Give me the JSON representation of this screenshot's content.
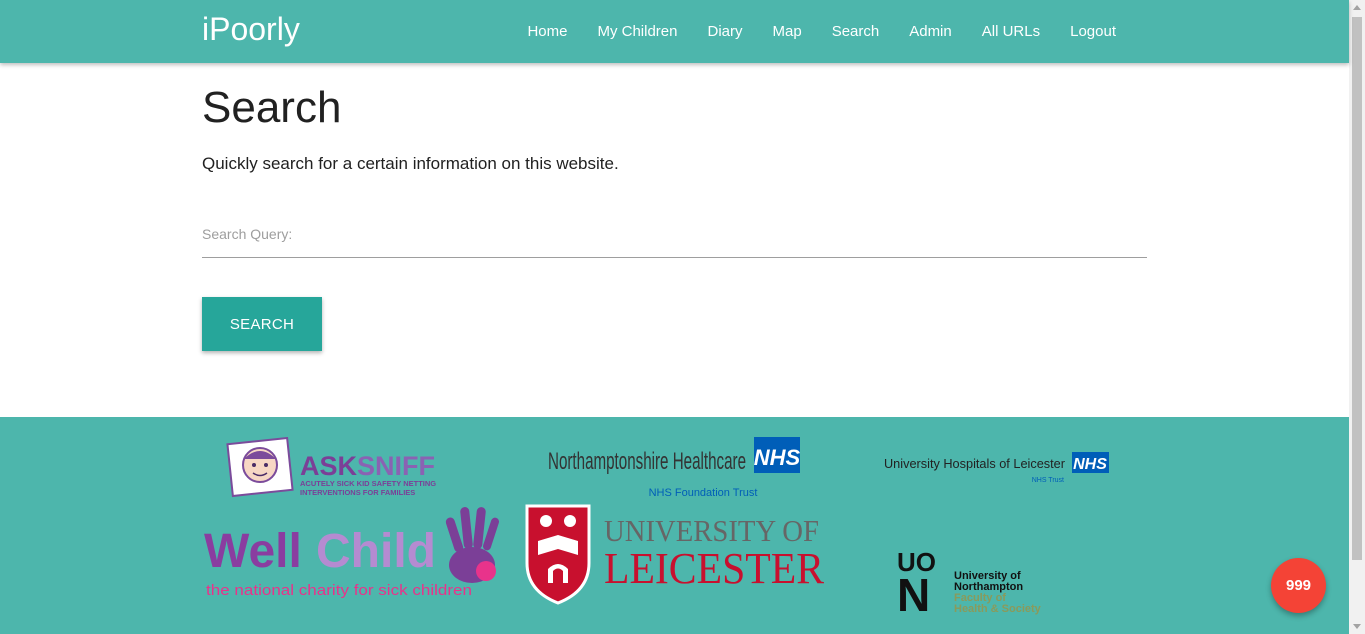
{
  "navbar": {
    "brand": "iPoorly",
    "links": [
      "Home",
      "My Children",
      "Diary",
      "Map",
      "Search",
      "Admin",
      "All URLs",
      "Logout"
    ]
  },
  "main": {
    "title": "Search",
    "description": "Quickly search for a certain information on this website.",
    "search_field": {
      "label": "Search Query:",
      "value": ""
    },
    "search_button": "SEARCH"
  },
  "footer": {
    "logos": {
      "asksniff": {
        "name": "ASKSNIFF",
        "tagline_1": "ACUTELY SICK KID SAFETY NETTING",
        "tagline_2": "INTERVENTIONS FOR FAMILIES"
      },
      "northants": {
        "name": "Northamptonshire Healthcare",
        "badge": "NHS",
        "sub": "NHS Foundation Trust"
      },
      "uhl": {
        "name": "University Hospitals of Leicester",
        "badge": "NHS",
        "sub": "NHS Trust"
      },
      "wellchild": {
        "name_1": "Well",
        "name_2": "Child",
        "tagline": "the national charity for sick children"
      },
      "uol": {
        "line_1": "UNIVERSITY OF",
        "line_2": "LEICESTER"
      },
      "uon": {
        "mark_1": "UO",
        "mark_2": "N",
        "line_1": "University of",
        "line_2": "Northampton",
        "line_3": "Faculty of",
        "line_4": "Health & Society"
      }
    }
  },
  "emergency_button": "999",
  "colors": {
    "primary": "#4db6ac",
    "button": "#26a69a",
    "emergency": "#f44336"
  }
}
